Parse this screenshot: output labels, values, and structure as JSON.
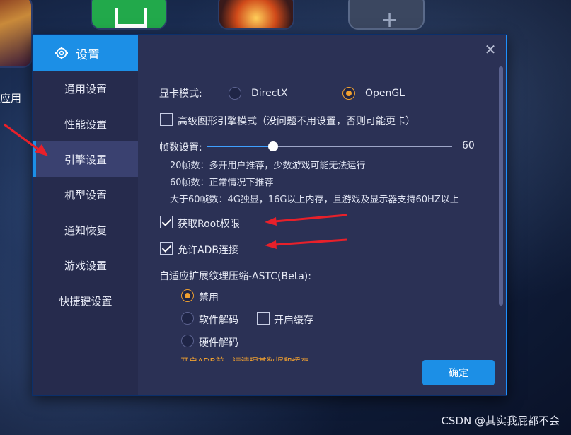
{
  "desktop": {
    "app_label": "应用"
  },
  "dialog": {
    "title": "设置",
    "nav": [
      "通用设置",
      "性能设置",
      "引擎设置",
      "机型设置",
      "通知恢复",
      "游戏设置",
      "快捷键设置"
    ],
    "active_nav": "引擎设置"
  },
  "engine": {
    "gpu_mode_label": "显卡模式:",
    "gpu_options": [
      "DirectX",
      "OpenGL"
    ],
    "gpu_selected": "OpenGL",
    "advanced_graphics_label": "高级图形引擎模式（没问题不用设置，否则可能更卡）",
    "advanced_graphics_checked": false,
    "fps_label": "帧数设置:",
    "fps_value": "60",
    "fps_notes": [
      "20帧数：多开用户推荐，少数游戏可能无法运行",
      "60帧数：正常情况下推荐",
      "大于60帧数：4G独显，16G以上内存，且游戏及显示器支持60HZ以上"
    ],
    "root_label": "获取Root权限",
    "root_checked": true,
    "adb_label": "允许ADB连接",
    "adb_checked": true,
    "astc_label": "自适应扩展纹理压缩-ASTC(Beta):",
    "astc_options": [
      "禁用",
      "软件解码",
      "硬件解码"
    ],
    "astc_selected": "禁用",
    "cache_label": "开启缓存",
    "cache_checked": false,
    "hint_partial": "开启ADB前，请清理某数据和缓存"
  },
  "footer": {
    "confirm_label": "确定"
  },
  "watermark": "CSDN @其实我屁都不会",
  "colors": {
    "accent": "#1c8fe6",
    "radio_on": "#f0a030",
    "annotation": "#e8202a"
  }
}
